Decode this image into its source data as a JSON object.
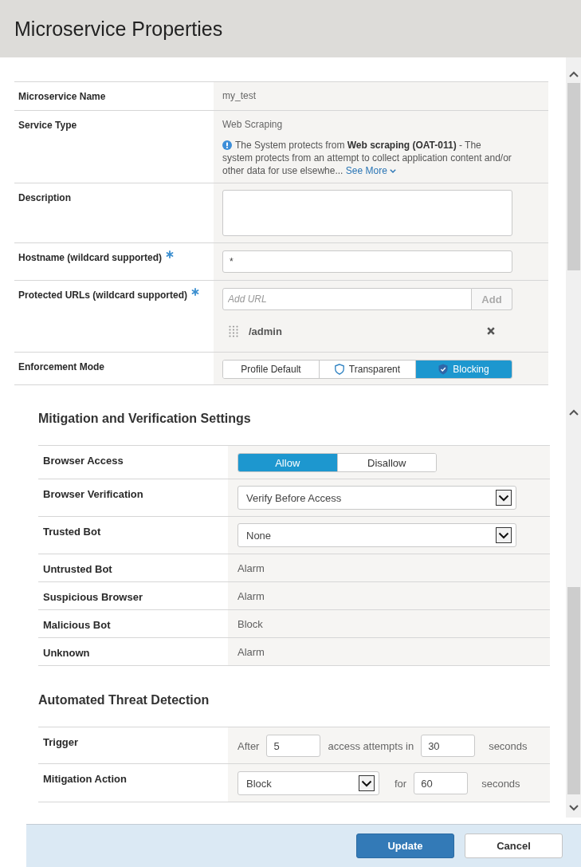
{
  "dialog": {
    "title": "Microservice Properties"
  },
  "properties": [
    {
      "kind": "text",
      "label": "Microservice Name",
      "value": "my_test"
    },
    {
      "kind": "service_type",
      "label": "Service Type",
      "value": "Web Scraping",
      "info": "The System protects from **Web scraping (OAT-011)** - The system protects from an attempt to collect application content and/or other data for use elsewhe...",
      "link": "See More"
    },
    {
      "kind": "textarea",
      "label": "Description"
    },
    {
      "kind": "input",
      "label": "Hostname (wildcard supported)",
      "required": true,
      "value": "*"
    },
    {
      "kind": "url_list",
      "label": "Protected URLs (wildcard supported)",
      "required": true,
      "placeholder": "Add URL",
      "add_button": {
        "label": "Add",
        "disabled": true
      },
      "urls": [
        "/admin"
      ]
    },
    {
      "kind": "segmented",
      "label": "Enforcement Mode",
      "options": [
        {
          "label": "Profile Default",
          "selected": false
        },
        {
          "label": "Transparent",
          "kind": "shield",
          "selected": false
        },
        {
          "label": "Blocking",
          "kind": "shield_check",
          "selected": true
        }
      ]
    }
  ],
  "mitigation": {
    "title": "Mitigation and Verification Settings",
    "rows": [
      {
        "kind": "segmented",
        "label": "Browser Access",
        "options": [
          {
            "label": "Allow",
            "selected": true
          },
          {
            "label": "Disallow",
            "selected": false
          }
        ]
      },
      {
        "kind": "select",
        "label": "Browser Verification",
        "value": "Verify Before Access"
      },
      {
        "kind": "select",
        "label": "Trusted Bot",
        "value": "None"
      },
      {
        "kind": "text",
        "label": "Untrusted Bot",
        "value": "Alarm"
      },
      {
        "kind": "text",
        "label": "Suspicious Browser",
        "value": "Alarm"
      },
      {
        "kind": "text",
        "label": "Malicious Bot",
        "value": "Block"
      },
      {
        "kind": "text",
        "label": "Unknown",
        "value": "Alarm"
      }
    ]
  },
  "threat_detection": {
    "title": "Automated Threat Detection",
    "rows": [
      {
        "kind": "inline",
        "label": "Trigger",
        "items": [
          {
            "kind": "text",
            "text": "After"
          },
          {
            "kind": "input",
            "value": "5"
          },
          {
            "kind": "text",
            "text": "access attempts in"
          },
          {
            "kind": "input",
            "value": "30"
          },
          {
            "kind": "text",
            "text": "seconds"
          }
        ]
      },
      {
        "kind": "inline",
        "label": "Mitigation Action",
        "items": [
          {
            "kind": "select",
            "value": "Block"
          },
          {
            "kind": "text",
            "text": "for"
          },
          {
            "kind": "input",
            "value": "60"
          },
          {
            "kind": "text",
            "text": "seconds"
          }
        ]
      }
    ]
  },
  "footer": {
    "buttons": [
      {
        "label": "Update",
        "kind": "primary"
      },
      {
        "label": "Cancel",
        "kind": "secondary"
      }
    ]
  }
}
